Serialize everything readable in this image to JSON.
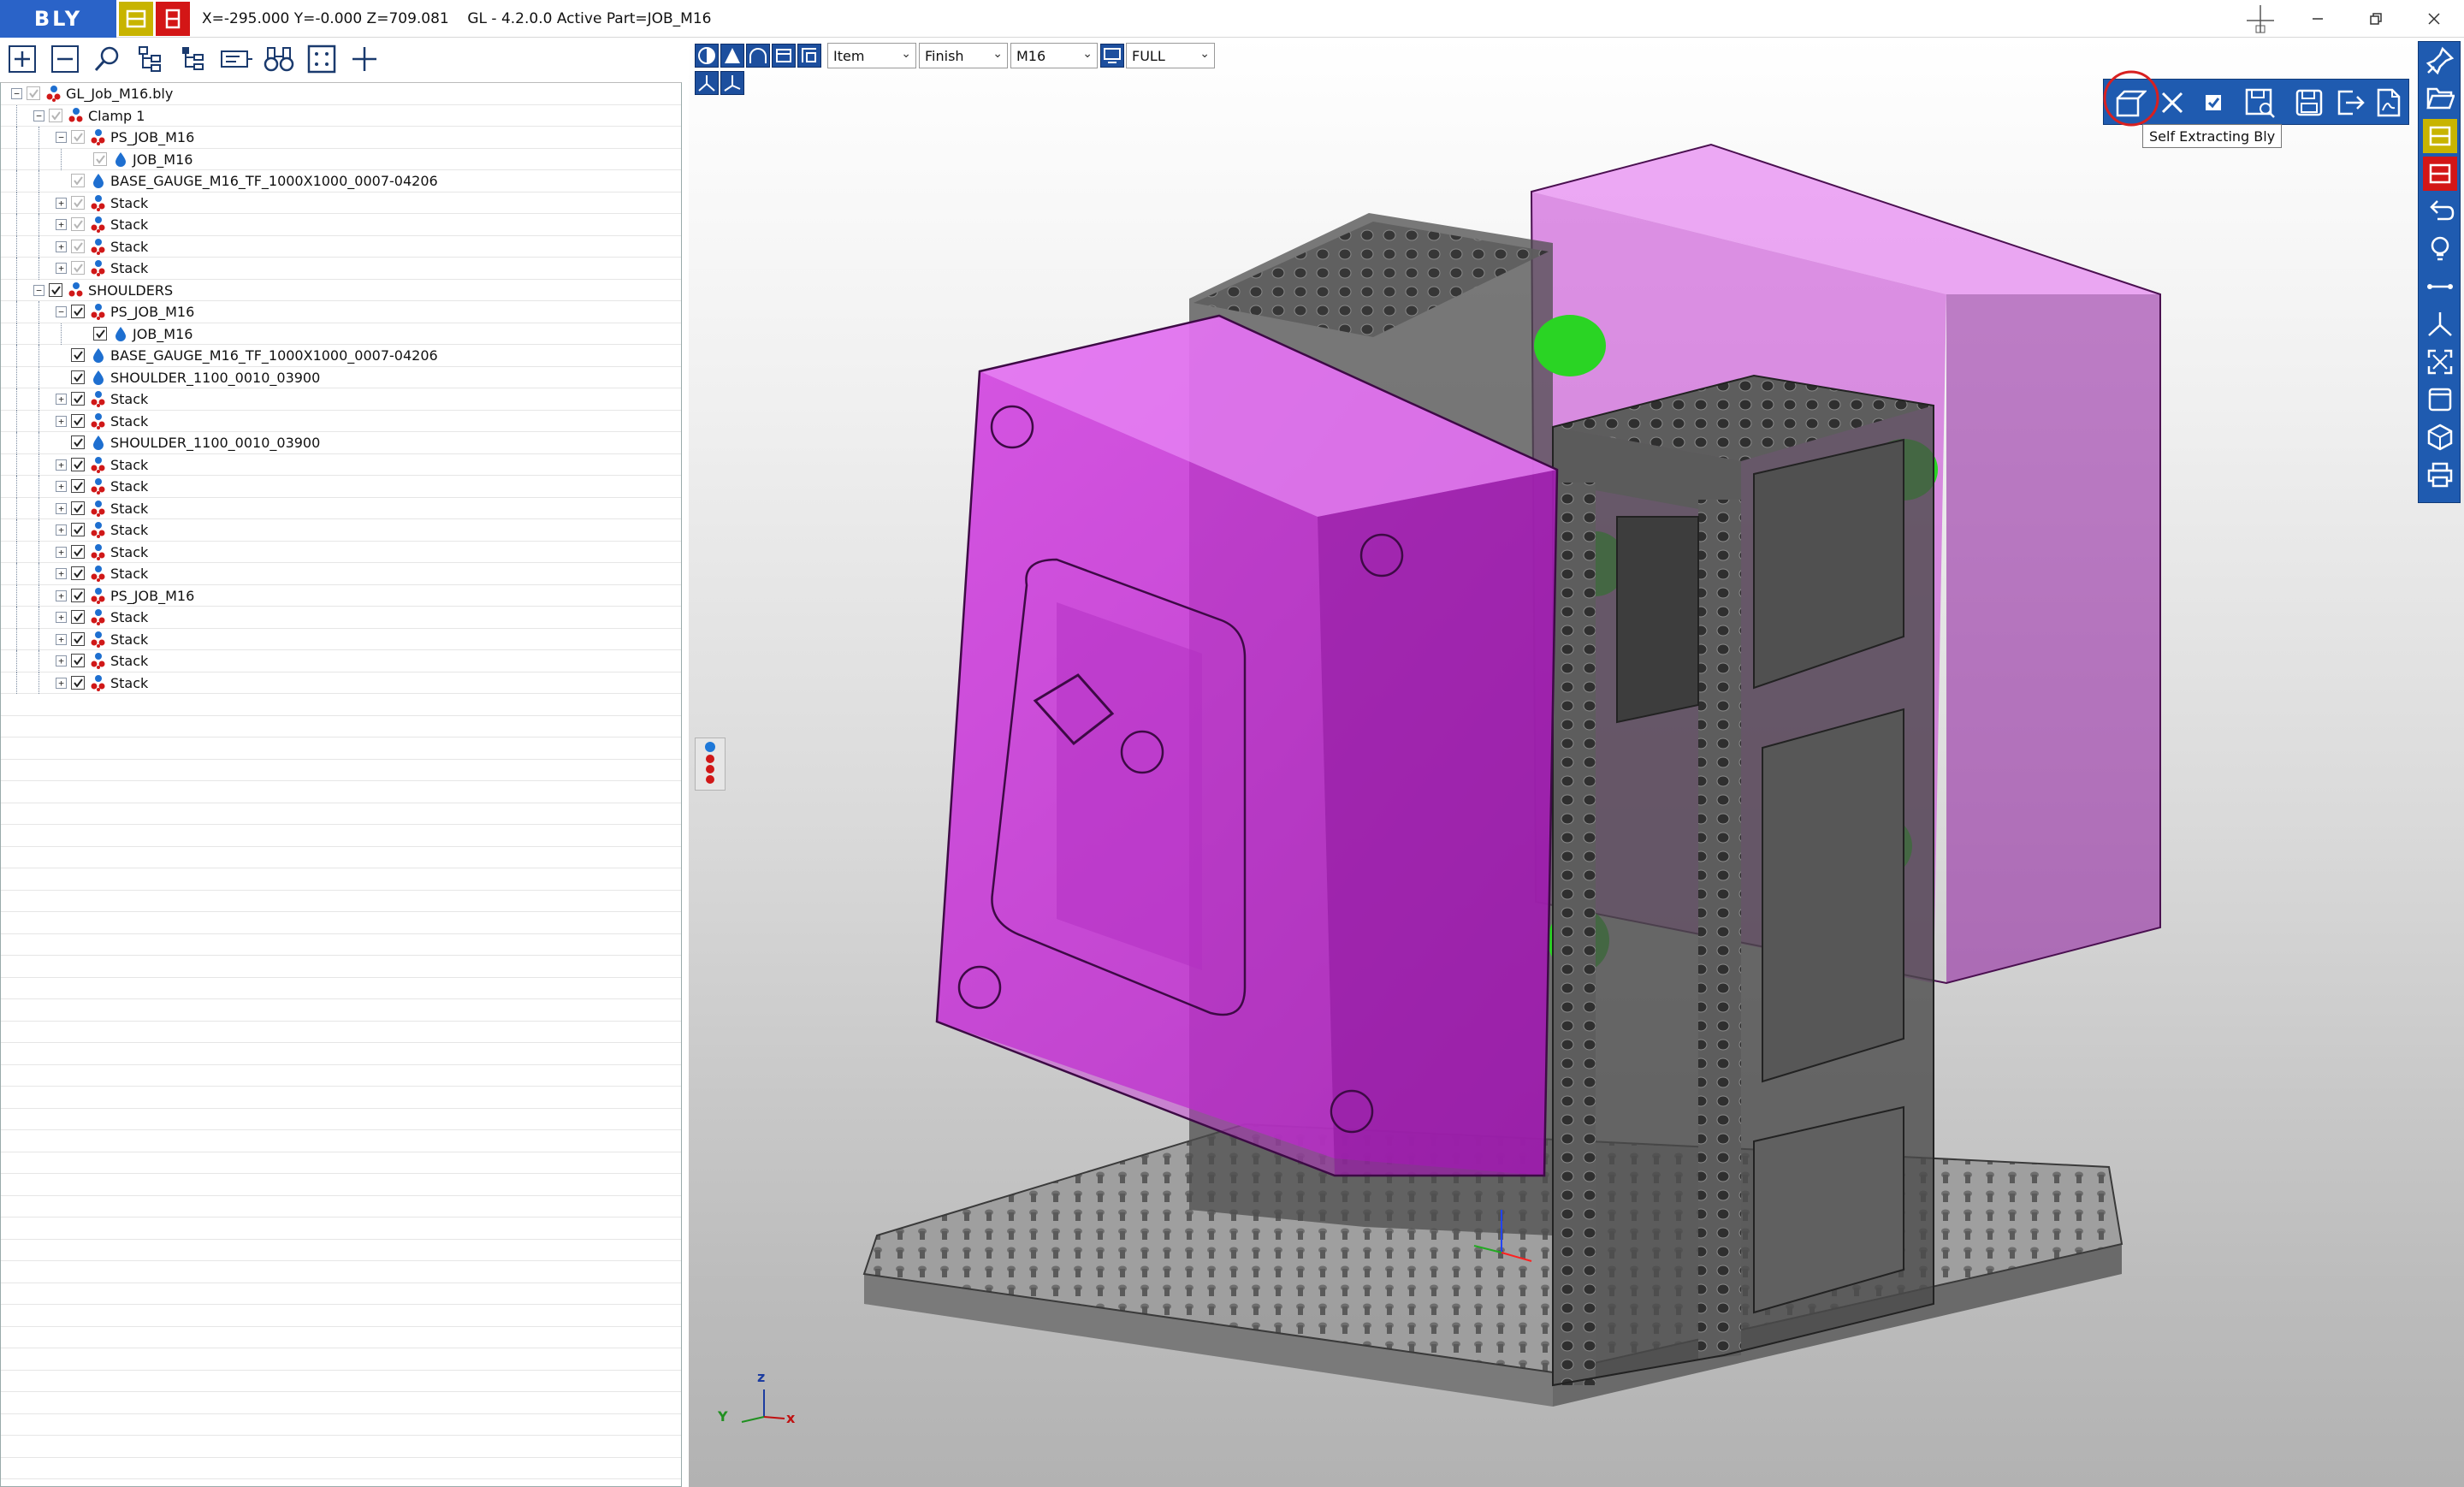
{
  "app": {
    "logo": "BLY",
    "status_text": "X=-295.000 Y=-0.000 Z=709.081    GL - 4.2.0.0 Active Part=JOB_M16",
    "window_controls": [
      "minimize-icon",
      "restore-icon",
      "close-icon"
    ]
  },
  "left_toolbar": {
    "icons": [
      "expand-plus-icon",
      "collapse-minus-icon",
      "search-icon",
      "tree-structure-icon",
      "tree-hierarchy-icon",
      "gauge-layout-icon",
      "binoculars-icon",
      "select-frame-icon",
      "crosshair-plus-icon"
    ]
  },
  "tree": {
    "rows": [
      {
        "label": "GL_Job_M16.bly",
        "depth": 0,
        "exp": "-",
        "icon": "assembly",
        "checked": true,
        "dim": true
      },
      {
        "label": "Clamp 1",
        "depth": 1,
        "exp": "-",
        "icon": "person-blue",
        "checked": true,
        "dim": true
      },
      {
        "label": "PS_JOB_M16",
        "depth": 2,
        "exp": "-",
        "icon": "assembly",
        "checked": true,
        "dim": true
      },
      {
        "label": "JOB_M16",
        "depth": 3,
        "exp": "",
        "icon": "drop",
        "checked": true,
        "dim": true
      },
      {
        "label": "BASE_GAUGE_M16_TF_1000X1000_0007-04206",
        "depth": 2,
        "exp": "",
        "icon": "drop",
        "checked": true,
        "dim": true
      },
      {
        "label": "Stack",
        "depth": 2,
        "exp": "+",
        "icon": "assembly",
        "checked": true,
        "dim": true
      },
      {
        "label": "Stack",
        "depth": 2,
        "exp": "+",
        "icon": "assembly",
        "checked": true,
        "dim": true
      },
      {
        "label": "Stack",
        "depth": 2,
        "exp": "+",
        "icon": "assembly",
        "checked": true,
        "dim": true
      },
      {
        "label": "Stack",
        "depth": 2,
        "exp": "+",
        "icon": "assembly",
        "checked": true,
        "dim": true
      },
      {
        "label": "SHOULDERS",
        "depth": 1,
        "exp": "-",
        "icon": "person-blue",
        "checked": true,
        "dim": false
      },
      {
        "label": "PS_JOB_M16",
        "depth": 2,
        "exp": "-",
        "icon": "assembly",
        "checked": true,
        "dim": false
      },
      {
        "label": "JOB_M16",
        "depth": 3,
        "exp": "",
        "icon": "drop",
        "checked": true,
        "dim": false
      },
      {
        "label": "BASE_GAUGE_M16_TF_1000X1000_0007-04206",
        "depth": 2,
        "exp": "",
        "icon": "drop",
        "checked": true,
        "dim": false
      },
      {
        "label": "SHOULDER_1100_0010_03900",
        "depth": 2,
        "exp": "",
        "icon": "drop",
        "checked": true,
        "dim": false
      },
      {
        "label": "Stack",
        "depth": 2,
        "exp": "+",
        "icon": "assembly",
        "checked": true,
        "dim": false
      },
      {
        "label": "Stack",
        "depth": 2,
        "exp": "+",
        "icon": "assembly",
        "checked": true,
        "dim": false
      },
      {
        "label": "SHOULDER_1100_0010_03900",
        "depth": 2,
        "exp": "",
        "icon": "drop",
        "checked": true,
        "dim": false
      },
      {
        "label": "Stack",
        "depth": 2,
        "exp": "+",
        "icon": "assembly",
        "checked": true,
        "dim": false
      },
      {
        "label": "Stack",
        "depth": 2,
        "exp": "+",
        "icon": "assembly",
        "checked": true,
        "dim": false
      },
      {
        "label": "Stack",
        "depth": 2,
        "exp": "+",
        "icon": "assembly",
        "checked": true,
        "dim": false
      },
      {
        "label": "Stack",
        "depth": 2,
        "exp": "+",
        "icon": "assembly",
        "checked": true,
        "dim": false
      },
      {
        "label": "Stack",
        "depth": 2,
        "exp": "+",
        "icon": "assembly",
        "checked": true,
        "dim": false
      },
      {
        "label": "Stack",
        "depth": 2,
        "exp": "+",
        "icon": "assembly",
        "checked": true,
        "dim": false
      },
      {
        "label": "PS_JOB_M16",
        "depth": 2,
        "exp": "+",
        "icon": "assembly",
        "checked": true,
        "dim": false
      },
      {
        "label": "Stack",
        "depth": 2,
        "exp": "+",
        "icon": "assembly",
        "checked": true,
        "dim": false
      },
      {
        "label": "Stack",
        "depth": 2,
        "exp": "+",
        "icon": "assembly",
        "checked": true,
        "dim": false
      },
      {
        "label": "Stack",
        "depth": 2,
        "exp": "+",
        "icon": "assembly",
        "checked": true,
        "dim": false
      },
      {
        "label": "Stack",
        "depth": 2,
        "exp": "+",
        "icon": "assembly",
        "checked": true,
        "dim": false
      }
    ]
  },
  "viewport_toolbar": {
    "mode_icons": [
      "shaded-mode-icon",
      "cone-mode-icon",
      "arch-mode-icon",
      "box-mode-icon",
      "frame-mode-icon",
      "axis-view-icon",
      "axis-view-alt-icon"
    ],
    "dropdowns": [
      {
        "name": "item-select",
        "value": "Item"
      },
      {
        "name": "finish-select",
        "value": "Finish"
      },
      {
        "name": "thread-select",
        "value": "M16"
      },
      {
        "name": "view-select",
        "value": "FULL"
      }
    ]
  },
  "floating_toolbar": {
    "icons": [
      "self-extract-icon",
      "close-icon",
      "checkbox-icon",
      "save-as-icon",
      "save-icon",
      "export-icon",
      "pdf-icon"
    ],
    "tooltip": "Self Extracting Bly"
  },
  "right_toolbar": {
    "icons": [
      "pin-icon",
      "open-folder-icon",
      "yellow-b-icon",
      "red-b-icon",
      "undo-icon",
      "lightbulb-icon",
      "measure-icon",
      "axis-icon",
      "fit-view-icon",
      "window-icon",
      "cube-icon",
      "print-icon"
    ]
  },
  "axis_triad": {
    "x": "x",
    "y": "Y",
    "z": "z"
  },
  "colors": {
    "accent_blue": "#1f5bb0",
    "logo_blue": "#2a63c8",
    "magenta_part": "#d22ee0",
    "green_clamp": "#2ad424",
    "yellow_btn": "#c8b400",
    "red_btn": "#d31616"
  }
}
